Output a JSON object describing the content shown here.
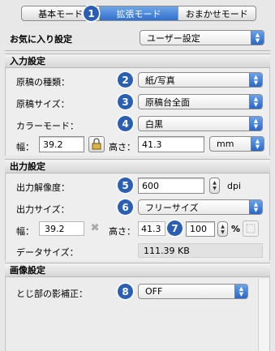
{
  "tabs": [
    {
      "label": "基本モード"
    },
    {
      "label": "拡張モード"
    },
    {
      "label": "おまかせモード"
    }
  ],
  "badges": [
    "1",
    "2",
    "3",
    "4",
    "5",
    "6",
    "7",
    "8"
  ],
  "favorites": {
    "label": "お気に入り設定",
    "value": "ユーザー設定"
  },
  "input_settings": {
    "title": "入力設定",
    "source_type": {
      "label": "原稿の種類：",
      "value": "紙/写真"
    },
    "source_size": {
      "label": "原稿サイズ：",
      "value": "原稿台全面"
    },
    "color_mode": {
      "label": "カラーモード：",
      "value": "白黒"
    },
    "width": {
      "label": "幅：",
      "value": "39.2"
    },
    "height": {
      "label": "高さ：",
      "value": "41.3"
    },
    "unit": "mm"
  },
  "output_settings": {
    "title": "出力設定",
    "resolution": {
      "label": "出力解像度：",
      "value": "600",
      "unit": "dpi"
    },
    "output_size": {
      "label": "出力サイズ：",
      "value": "フリーサイズ"
    },
    "width": {
      "label": "幅：",
      "value": "39.2"
    },
    "height": {
      "label": "高さ：",
      "value": "41.3"
    },
    "scale": {
      "value": "100",
      "unit": "%"
    },
    "data_size": {
      "label": "データサイズ：",
      "value": "111.39 KB"
    }
  },
  "image_settings": {
    "title": "画像設定",
    "gutter_correction": {
      "label": "とじ部の影補正：",
      "value": "OFF"
    }
  }
}
